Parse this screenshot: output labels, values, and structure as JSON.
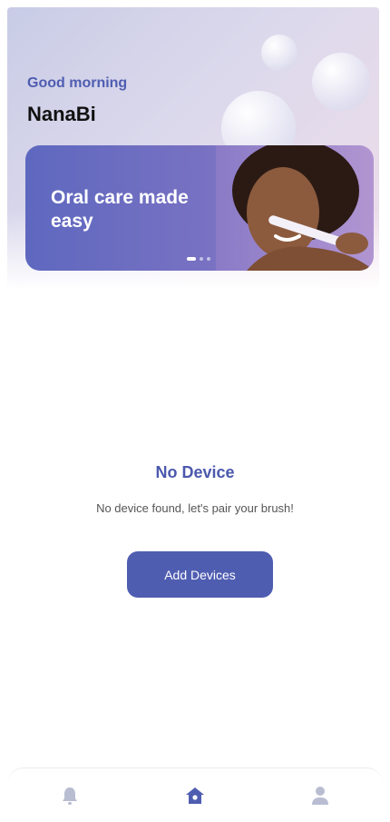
{
  "header": {
    "greeting": "Good morning",
    "username": "NanaBi"
  },
  "banner": {
    "title": "Oral care made easy",
    "slide_count": 3,
    "active_slide": 1
  },
  "empty_state": {
    "title": "No Device",
    "message": "No device found, let's pair your brush!",
    "button_label": "Add Devices"
  },
  "tabbar": {
    "items": [
      {
        "icon": "bell-icon",
        "active": false
      },
      {
        "icon": "home-icon",
        "active": true
      },
      {
        "icon": "profile-icon",
        "active": false
      }
    ]
  },
  "colors": {
    "accent": "#4f5db1",
    "banner_start": "#5e68bf",
    "banner_end": "#b59ad3",
    "inactive_icon": "#b9bdd2"
  }
}
